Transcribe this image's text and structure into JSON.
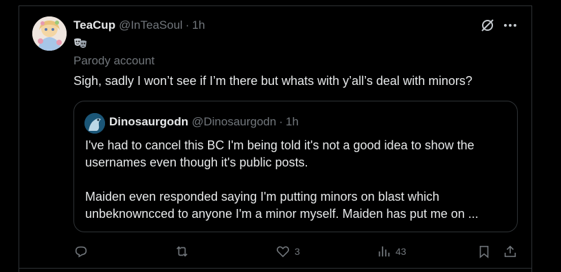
{
  "post": {
    "display_name": "TeaCup",
    "handle": "@InTeaSoul",
    "separator": "·",
    "time": "1h",
    "badge_label": "Parody account",
    "text": "Sigh, sadly I won’t see if I’m there but whats with y’all’s deal with minors?",
    "icons": {
      "grok": "grok-icon",
      "more": "more-icon",
      "mask": "performing-arts-icon"
    }
  },
  "quote": {
    "display_name": "Dinosaurgodn",
    "handle": "@Dinosaurgodn",
    "separator": "·",
    "time": "1h",
    "line1": "I've had to cancel this BC I'm being told it's not a good idea to show the",
    "line2": "usernames even though it's public posts.",
    "line3": "Maiden even responded saying I'm putting minors on blast which",
    "line4": "unbeknowncced to anyone I'm a minor myself. Maiden has put me on ..."
  },
  "actions": {
    "reply_count": "",
    "repost_count": "",
    "like_count": "3",
    "views_count": "43"
  },
  "colors": {
    "background": "#000000",
    "text": "#e7e9ea",
    "muted": "#71767b",
    "border": "#2f3336"
  }
}
